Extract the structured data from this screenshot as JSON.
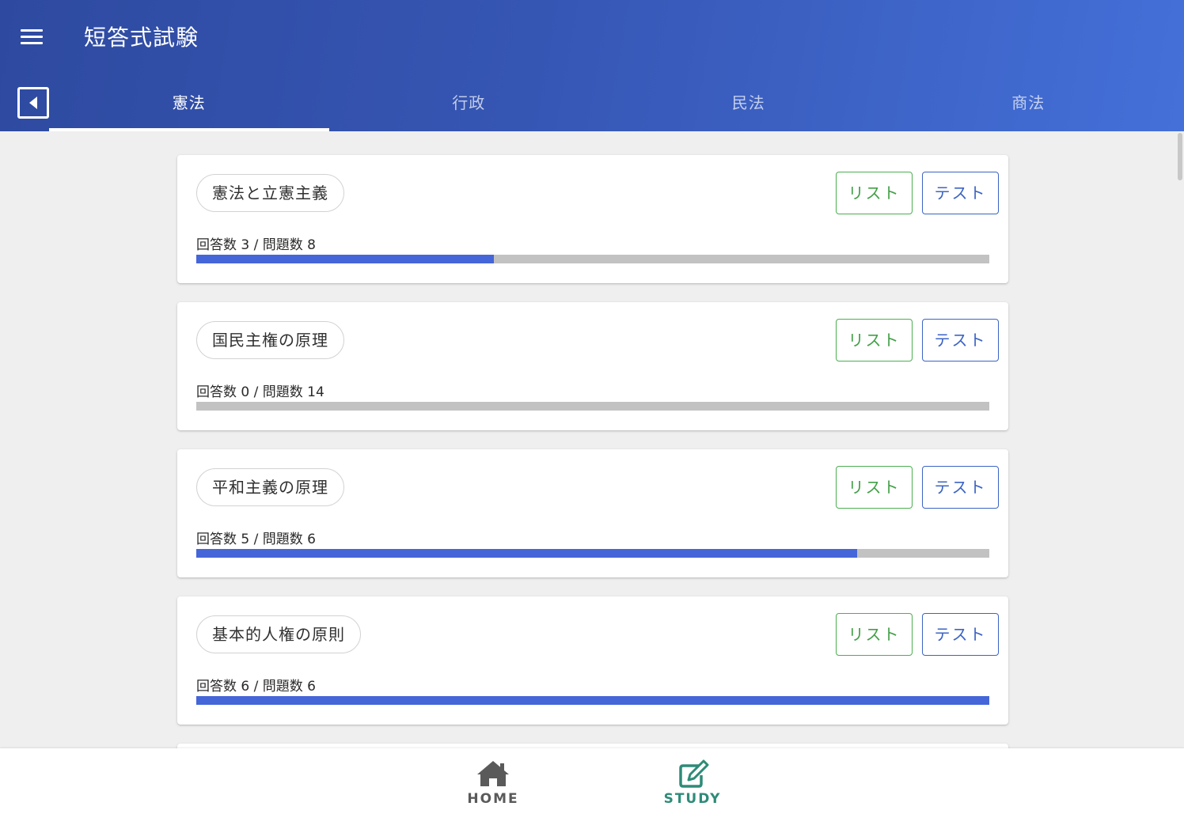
{
  "app": {
    "title": "短答式試験"
  },
  "tabs": [
    {
      "label": "憲法",
      "active": true
    },
    {
      "label": "行政",
      "active": false
    },
    {
      "label": "民法",
      "active": false
    },
    {
      "label": "商法",
      "active": false
    }
  ],
  "cards": [
    {
      "title": "憲法と立憲主義",
      "list_label": "リスト",
      "test_label": "テスト",
      "progress_text": "回答数 3 / 問題数 8",
      "answered": 3,
      "total": 8
    },
    {
      "title": "国民主権の原理",
      "list_label": "リスト",
      "test_label": "テスト",
      "progress_text": "回答数 0 / 問題数 14",
      "answered": 0,
      "total": 14
    },
    {
      "title": "平和主義の原理",
      "list_label": "リスト",
      "test_label": "テスト",
      "progress_text": "回答数 5 / 問題数 6",
      "answered": 5,
      "total": 6
    },
    {
      "title": "基本的人権の原則",
      "list_label": "リスト",
      "test_label": "テスト",
      "progress_text": "回答数 6 / 問題数 6",
      "answered": 6,
      "total": 6
    }
  ],
  "bottom_nav": {
    "home_label": "HOME",
    "study_label": "STUDY",
    "active": "study"
  },
  "colors": {
    "header_start": "#2e4aa0",
    "header_end": "#4470d8",
    "progress_fill": "#4566d8",
    "progress_track": "#c2c2c2",
    "list_button": "#43a047",
    "test_button": "#3c64c4",
    "nav_active": "#2e8b78",
    "nav_inactive": "#5a5a5a"
  },
  "icons": [
    "menu-icon",
    "back-arrow-icon",
    "home-icon",
    "edit-icon"
  ]
}
